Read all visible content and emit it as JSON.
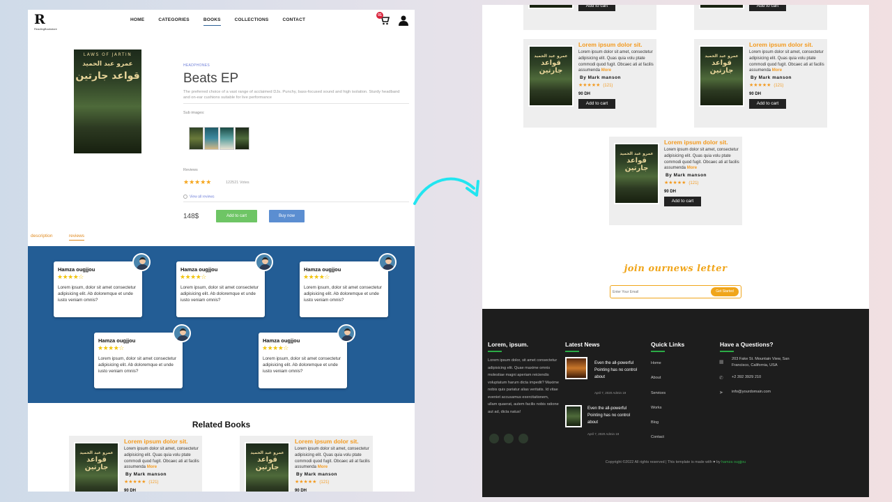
{
  "nav": {
    "logo_letter": "R",
    "logo_sub": "ReadingBookstore",
    "items": [
      "HOME",
      "CATEGORIES",
      "BOOKS",
      "COLLECTIONS",
      "CONTACT"
    ],
    "active": "BOOKS",
    "cart_count": "01"
  },
  "product": {
    "cover_top": "LAWS OF JARTIN",
    "cover_author": "عمرو عبد الحميد",
    "cover_title": "قواعد جارتين",
    "genre": "HEADPHONES",
    "title": "Beats EP",
    "description": "The preferred choice of a vast range of acclaimed DJs. Punchy, bass-focused sound and high isolation. Sturdy headband and on-ear cushions suitable for live performance",
    "sub_images_label": "Sub images:",
    "reviews_label": "Reviews",
    "stars": "★★★★★",
    "votes": "122521 Votes",
    "view_all": "View all reviews",
    "price": "148$",
    "add_to_cart": "Add to cart",
    "buy_now": "Buy now"
  },
  "tabs": {
    "description": "description",
    "reviews": "reviews",
    "active": "reviews"
  },
  "reviews": [
    {
      "name": "Hamza ougjjou",
      "stars": "★★★★☆",
      "text": "Lorem ipsum, dolor sit amet consectetur adipisicing elit. Ab doloremque et unde iusto veniam omnis?"
    },
    {
      "name": "Hamza ougjjou",
      "stars": "★★★★☆",
      "text": "Lorem ipsum, dolor sit amet consectetur adipisicing elit. Ab doloremque et unde iusto veniam omnis?"
    },
    {
      "name": "Hamza ougjjou",
      "stars": "★★★★☆",
      "text": "Lorem ipsum, dolor sit amet consectetur adipisicing elit. Ab doloremque et unde iusto veniam omnis?"
    },
    {
      "name": "Hamza ougjjou",
      "stars": "★★★★☆",
      "text": "Lorem ipsum, dolor sit amet consectetur adipisicing elit. Ab doloremque et unde iusto veniam omnis?"
    },
    {
      "name": "Hamza ougjjou",
      "stars": "★★★★☆",
      "text": "Lorem ipsum, dolor sit amet consectetur adipisicing elit. Ab doloremque et unde iusto veniam omnis?"
    }
  ],
  "related": {
    "title": "Related Books",
    "book": {
      "title": "Lorem ipsum dolor sit.",
      "desc": "Lorem ipsum dolor sit amet, consectetur adipisicing elit. Quas quia volu ptate commodi quod fugit. Obcaec ati at facilis assumenda",
      "more": "More",
      "author": "By Mark manson",
      "stars": "★★★★★",
      "count": "(121)",
      "price": "90 DH",
      "add": "Add to cart"
    }
  },
  "newsletter": {
    "title": "join ournews letter",
    "placeholder": "Enter Your Email",
    "button": "Get Started"
  },
  "footer": {
    "about_title": "Lorem, ipsum.",
    "about_text": "Lorem ipsum dolor, sit amet consectetur adipisicing elit. Quae maxime omnis molestiae magni aperiam reiciendis voluptatum harum dicta impedit? Maxime nobis quis pariatur alias veritatis. Id vitae eveniet accusamus exercitationem, ullam quaerat, autem facilis nobis ratione aut ad, dicta natus!",
    "news_title": "Latest News",
    "news": [
      {
        "text": "Even the all-powerful Pointing has no control about",
        "meta": "April 7, 2020 Admin 19"
      },
      {
        "text": "Even the all-powerful Pointing has no control about",
        "meta": "April 7, 2020 Admin 19"
      }
    ],
    "links_title": "Quick Links",
    "links": [
      "Home",
      "About",
      "Services",
      "Works",
      "Blog",
      "Contact"
    ],
    "questions_title": "Have a Questions?",
    "address": "203 Fake St. Mountain View, San Francisco, California, USA",
    "phone": "+2 392 3929 210",
    "email": "info@yourdomain.com",
    "copyright": "Copyright ©2022 All rights reserved | This template is made with",
    "by": "by",
    "author_link": "hamza ougjjou"
  },
  "colors": {
    "accent": "#f39a1f",
    "band": "#235d95",
    "footer": "#1d1d1d",
    "green": "#2bab46"
  }
}
